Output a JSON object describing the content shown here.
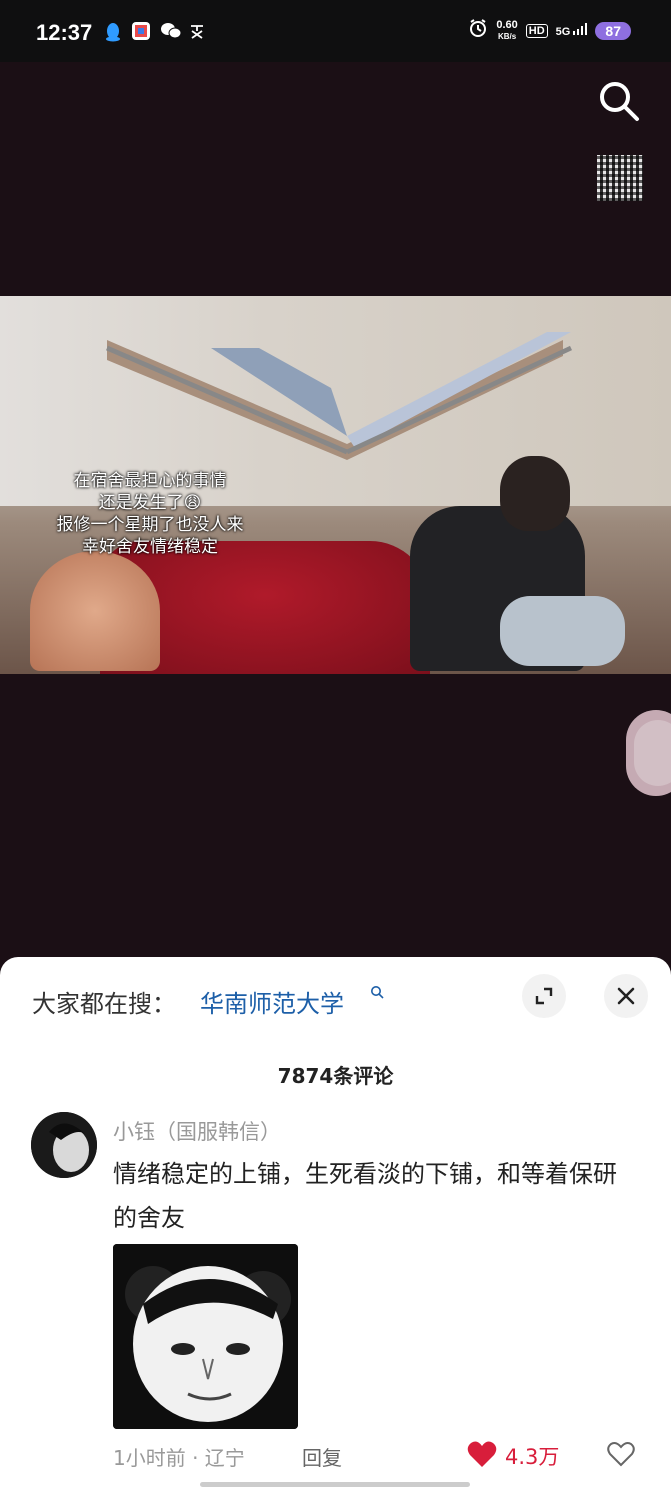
{
  "status_bar": {
    "time": "12:37",
    "net_speed_value": "0.60",
    "net_speed_unit": "KB/s",
    "hd": "HD",
    "signal": "5G",
    "battery": "87",
    "icons": [
      "qq-icon",
      "app-icon",
      "wechat-icon",
      "pinyin-icon",
      "alarm-icon"
    ]
  },
  "video": {
    "subtitle": [
      "在宿舍最担心的事情",
      "还是发生了😩",
      "报修一个星期了也没人来",
      "幸好舍友情绪稳定"
    ]
  },
  "comments_sheet": {
    "trending_label": "大家都在搜：",
    "trending_query": "华南师范大学",
    "comment_count": "7874条评论",
    "comment": {
      "username": "小钰（国服韩信）",
      "text": "情绪稳定的上铺，生死看淡的下铺，和等着保研的舍友",
      "time_location": "1小时前 · 辽宁",
      "reply_label": "回复",
      "likes": "4.3万"
    }
  },
  "colors": {
    "accent_link": "#1d5fa8",
    "like_red": "#d81e3b",
    "battery": "#8e6fe0",
    "video_bg": "#1b0f15"
  }
}
